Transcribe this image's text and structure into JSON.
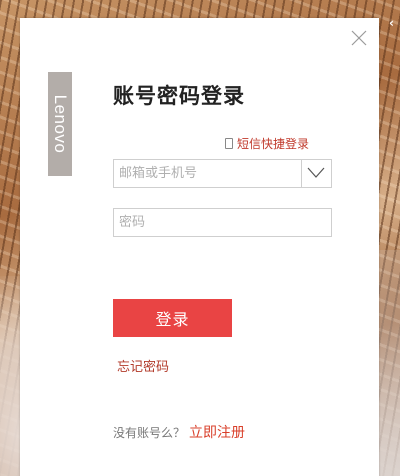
{
  "brand": {
    "name": "Lenovo"
  },
  "login": {
    "title": "账号密码登录",
    "sms_login_label": "短信快捷登录",
    "account_placeholder": "邮箱或手机号",
    "account_value": "",
    "password_placeholder": "密码",
    "password_value": "",
    "submit_label": "登录",
    "forgot_password_label": "忘记密码",
    "register_prompt": "没有账号么？",
    "register_label": "立即注册"
  },
  "colors": {
    "accent": "#e94444",
    "link": "#c0392b",
    "brand_tab": "#b3ada9"
  },
  "icons": {
    "close": "close-icon",
    "dropdown": "chevron-down-icon",
    "phone": "phone-icon"
  }
}
